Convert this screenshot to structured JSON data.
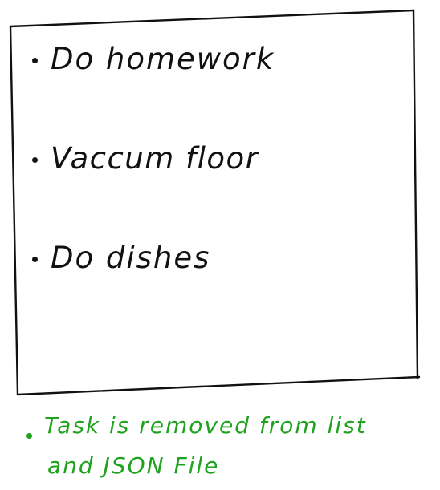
{
  "todo_list": {
    "items": [
      {
        "label": "Do homework"
      },
      {
        "label": "Vaccum floor"
      },
      {
        "label": "Do dishes"
      }
    ]
  },
  "note": {
    "line1": "Task is removed from list",
    "line2": "and JSON File"
  },
  "colors": {
    "ink": "#111111",
    "note": "#1fa31f",
    "background": "#ffffff"
  }
}
